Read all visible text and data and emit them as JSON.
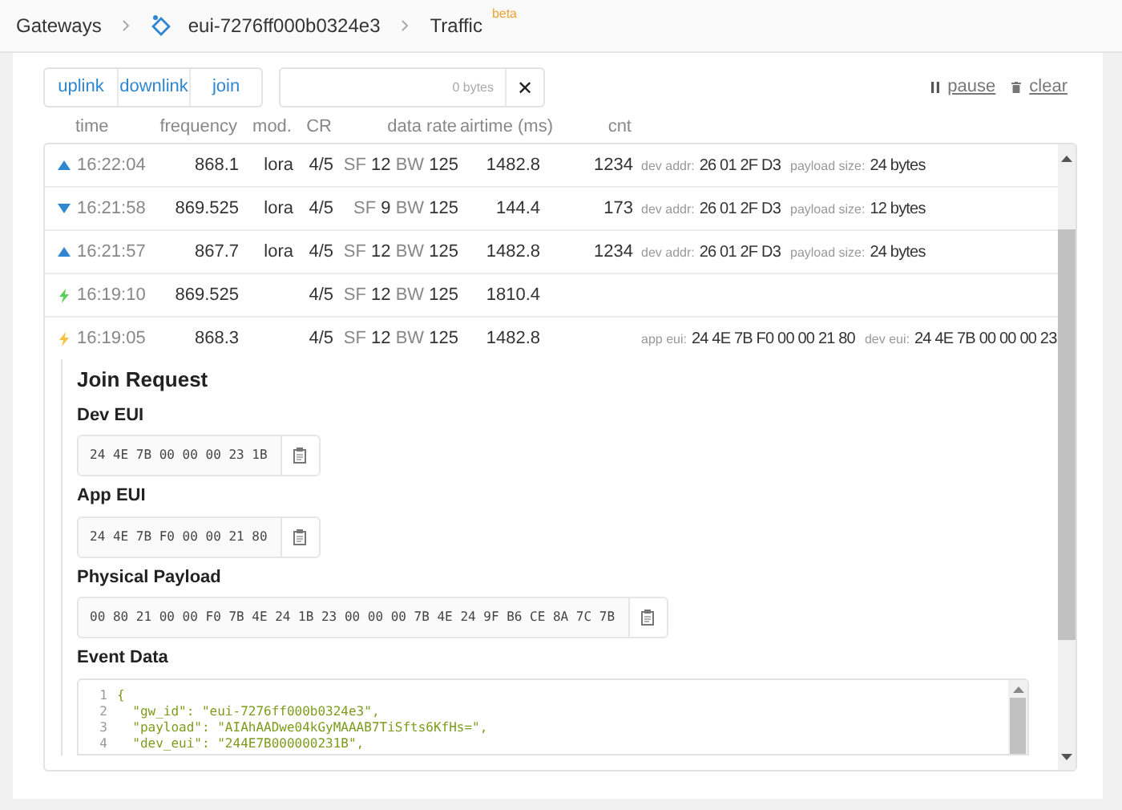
{
  "breadcrumbs": [
    {
      "label": "Gateways",
      "kind": "text"
    },
    {
      "label": "eui-7276ff000b0324e3",
      "kind": "gateway"
    },
    {
      "label": "Traffic",
      "kind": "text",
      "badge": "beta"
    }
  ],
  "filters": [
    {
      "label": "uplink"
    },
    {
      "label": "downlink"
    },
    {
      "label": "join"
    }
  ],
  "payload_filter": {
    "byte_count": "0 bytes",
    "clear": "✕"
  },
  "actions": [
    {
      "label": "pause",
      "kind": "pause"
    },
    {
      "label": "clear",
      "kind": "clear"
    }
  ],
  "table": {
    "columns": [
      "time",
      "frequency",
      "mod.",
      "CR",
      "data rate",
      "airtime (ms)",
      "cnt"
    ],
    "rows": [
      {
        "kind": "uplink",
        "time": "16:22:04",
        "frequency": "868.1",
        "modulation": "lora",
        "cr": "4/5",
        "sf_label": "SF",
        "sf": "12",
        "bw_label": "BW",
        "bw": "125",
        "airtime": "1482.8",
        "cnt": "1234",
        "details": [
          {
            "label": "dev addr:",
            "value": "26 01 2F D3"
          },
          {
            "label": "payload size:",
            "value": "24 bytes"
          }
        ],
        "expanded": false
      },
      {
        "kind": "downlink",
        "time": "16:21:58",
        "frequency": "869.525",
        "modulation": "lora",
        "cr": "4/5",
        "sf_label": "SF",
        "sf": "9",
        "bw_label": "BW",
        "bw": "125",
        "airtime": "144.4",
        "cnt": "173",
        "details": [
          {
            "label": "dev addr:",
            "value": "26 01 2F D3"
          },
          {
            "label": "payload size:",
            "value": "12 bytes"
          }
        ],
        "expanded": false
      },
      {
        "kind": "uplink",
        "time": "16:21:57",
        "frequency": "867.7",
        "modulation": "lora",
        "cr": "4/5",
        "sf_label": "SF",
        "sf": "12",
        "bw_label": "BW",
        "bw": "125",
        "airtime": "1482.8",
        "cnt": "1234",
        "details": [
          {
            "label": "dev addr:",
            "value": "26 01 2F D3"
          },
          {
            "label": "payload size:",
            "value": "24 bytes"
          }
        ],
        "expanded": false
      },
      {
        "kind": "join_accept",
        "time": "16:19:10",
        "frequency": "869.525",
        "cr": "4/5",
        "sf_label": "SF",
        "sf": "12",
        "bw_label": "BW",
        "bw": "125",
        "airtime": "1810.4",
        "details": [],
        "expanded": false
      },
      {
        "kind": "join_request",
        "time": "16:19:05",
        "frequency": "868.3",
        "cr": "4/5",
        "sf_label": "SF",
        "sf": "12",
        "bw_label": "BW",
        "bw": "125",
        "airtime": "1482.8",
        "details": [
          {
            "label": "app eui:",
            "value": "24 4E 7B F0 00 00 21 80"
          },
          {
            "label": "dev eui:",
            "value": "24 4E 7B 00 00 00 23"
          }
        ],
        "expanded": true,
        "detail": {
          "title": "Join Request",
          "fields": [
            {
              "label": "Dev EUI",
              "value": "24 4E 7B 00 00 00 23 1B"
            },
            {
              "label": "App EUI",
              "value": "24 4E 7B F0 00 00 21 80"
            },
            {
              "label": "Physical Payload",
              "value": "00 80 21 00 00 F0 7B 4E 24 1B 23 00 00 00 7B 4E 24 9F B6 CE 8A 7C 7B"
            }
          ],
          "event_data": {
            "title": "Event Data",
            "lines": [
              {
                "number": "1",
                "text": "{"
              },
              {
                "number": "2",
                "text": "  \"gw_id\": \"eui-7276ff000b0324e3\","
              },
              {
                "number": "3",
                "text": "  \"payload\": \"AIAhAADwe04kGyMAAAB7TiSfts6KfHs=\","
              },
              {
                "number": "4",
                "text": "  \"dev_eui\": \"244E7B000000231B\","
              }
            ]
          }
        }
      }
    ]
  }
}
